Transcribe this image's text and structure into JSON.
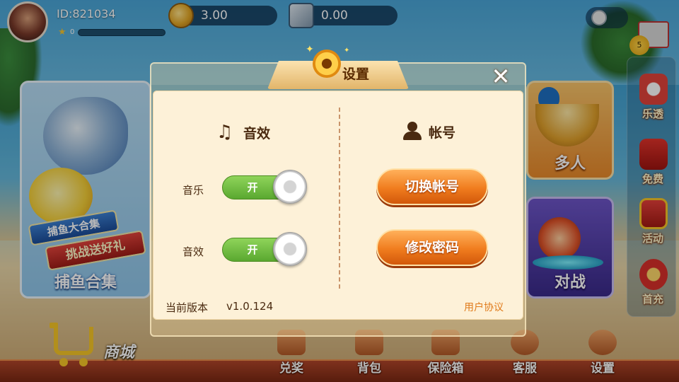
{
  "user": {
    "id_label": "ID:821034",
    "level": "0"
  },
  "currency": {
    "gold": "3.00",
    "cards": "0.00"
  },
  "gift": {
    "count": "5"
  },
  "side_menu": [
    {
      "label": "乐透",
      "icon": "claw-machine-icon"
    },
    {
      "label": "免费",
      "icon": "red-envelope-icon"
    },
    {
      "label": "活动",
      "icon": "gift-icon"
    },
    {
      "label": "首充",
      "icon": "money-bag-icon"
    }
  ],
  "tiles": {
    "fish": {
      "banner1": "捕鱼大合集",
      "banner2": "挑战送好礼",
      "caption": "捕鱼合集"
    },
    "multi": {
      "caption": "多人"
    },
    "duel": {
      "caption": "对战"
    }
  },
  "shop": {
    "label": "商城"
  },
  "bottom_nav": [
    {
      "label": "兑奖",
      "icon": "prize-box-icon"
    },
    {
      "label": "背包",
      "icon": "backpack-icon"
    },
    {
      "label": "保险箱",
      "icon": "safe-icon"
    },
    {
      "label": "客服",
      "icon": "phone-icon"
    },
    {
      "label": "设置",
      "icon": "gear-icon"
    }
  ],
  "dialog": {
    "title": "设置",
    "close": "✕",
    "sound_section": "音效",
    "account_section": "帐号",
    "music_label": "音乐",
    "music_toggle": "开",
    "sfx_label": "音效",
    "sfx_toggle": "开",
    "switch_account": "切换帐号",
    "change_password": "修改密码",
    "version_label": "当前版本",
    "version_value": "v1.0.124",
    "user_agreement": "用户协议"
  },
  "colors": {
    "toggle_on": "#6bbd3a",
    "button_orange": "#f07c1e",
    "link_orange": "#e07a1a"
  }
}
